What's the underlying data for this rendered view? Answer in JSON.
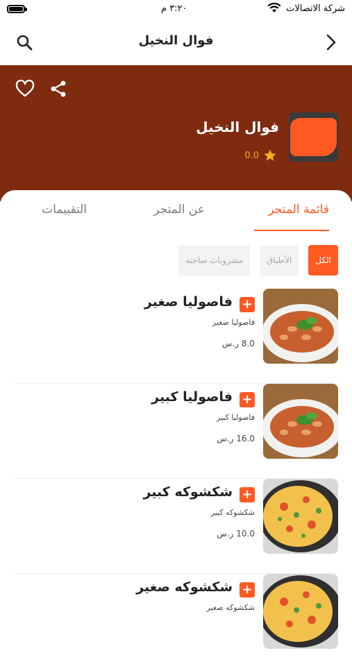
{
  "status_bar": {
    "carrier": "شركة الاتصالات",
    "time": "٣:٢٠ م"
  },
  "navbar": {
    "title": "فوال النخيل"
  },
  "store": {
    "name": "فوال النخيل",
    "rating": "0.0"
  },
  "tabs": [
    {
      "label": "قائمة المتجر",
      "active": true
    },
    {
      "label": "عن المتجر",
      "active": false
    },
    {
      "label": "التقييمات",
      "active": false
    }
  ],
  "categories": [
    {
      "label": "الكل",
      "active": true
    },
    {
      "label": "الأطباق",
      "active": false
    },
    {
      "label": "مشروبات ساخنه",
      "active": false
    }
  ],
  "items": [
    {
      "name": "فاصوليا صغير",
      "desc": "فاصوليا صغير",
      "price": "8.0 ر.س",
      "image": "beans-dish"
    },
    {
      "name": "فاصوليا كبير",
      "desc": "فاصوليا كبير",
      "price": "16.0 ر.س",
      "image": "beans-dish"
    },
    {
      "name": "شكشوكه كبير",
      "desc": "شكشوكه كبير",
      "price": "10.0 ر.س",
      "image": "shakshuka-pan"
    },
    {
      "name": "شكشوكه صغير",
      "desc": "شكشوكه صغير",
      "price": "",
      "image": "shakshuka-pan"
    }
  ],
  "colors": {
    "accent": "#ff5a22",
    "hero_bg": "#7e2b10",
    "star": "#f3b21a"
  }
}
